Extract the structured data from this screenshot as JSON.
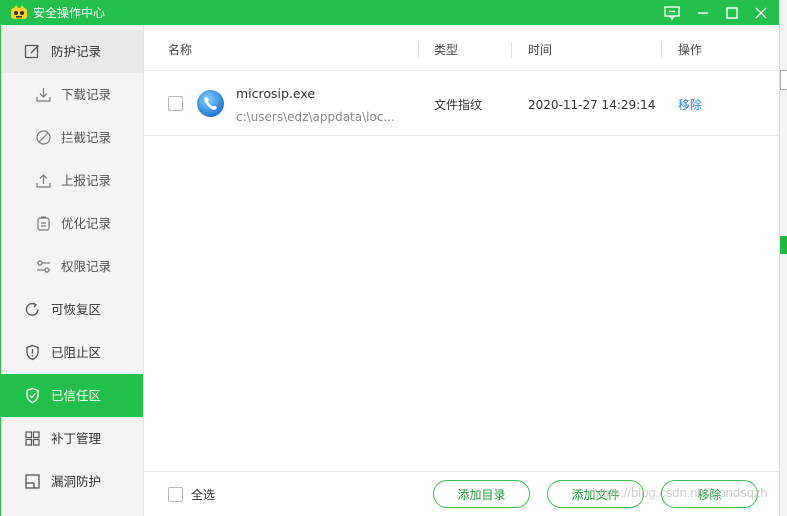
{
  "window": {
    "title": "安全操作中心",
    "accent_color": "#23c04b"
  },
  "titlebar_buttons": [
    {
      "name": "feedback-icon"
    },
    {
      "name": "minimize-icon"
    },
    {
      "name": "maximize-icon"
    },
    {
      "name": "close-icon"
    }
  ],
  "sidebar": {
    "items": [
      {
        "label": "防护记录",
        "icon": "edit-record-icon",
        "level": "top",
        "state": "expanded"
      },
      {
        "label": "下载记录",
        "icon": "download-icon",
        "level": "sub",
        "state": "normal"
      },
      {
        "label": "拦截记录",
        "icon": "block-icon",
        "level": "sub",
        "state": "normal"
      },
      {
        "label": "上报记录",
        "icon": "upload-icon",
        "level": "sub",
        "state": "normal"
      },
      {
        "label": "优化记录",
        "icon": "clipboard-icon",
        "level": "sub",
        "state": "normal"
      },
      {
        "label": "权限记录",
        "icon": "sliders-icon",
        "level": "sub",
        "state": "normal"
      },
      {
        "label": "可恢复区",
        "icon": "restore-icon",
        "level": "top",
        "state": "normal"
      },
      {
        "label": "已阻止区",
        "icon": "shield-alert-icon",
        "level": "top",
        "state": "normal"
      },
      {
        "label": "已信任区",
        "icon": "shield-check-icon",
        "level": "top",
        "state": "active"
      },
      {
        "label": "补丁管理",
        "icon": "grid-icon",
        "level": "top",
        "state": "normal"
      },
      {
        "label": "漏洞防护",
        "icon": "window-icon",
        "level": "top",
        "state": "normal"
      }
    ]
  },
  "table": {
    "columns": [
      "名称",
      "类型",
      "时间",
      "操作"
    ],
    "rows": [
      {
        "name": "microsip.exe",
        "path": "c:\\users\\edz\\appdata\\loc...",
        "type": "文件指纹",
        "time": "2020-11-27 14:29:14",
        "action": "移除",
        "icon": "phone-app-icon",
        "checked": false
      }
    ]
  },
  "footer": {
    "select_all": "全选",
    "add_directory": "添加目录",
    "add_file": "添加文件",
    "remove": "移除"
  },
  "watermark": "https://blog.csdn.net/sondsqzh"
}
